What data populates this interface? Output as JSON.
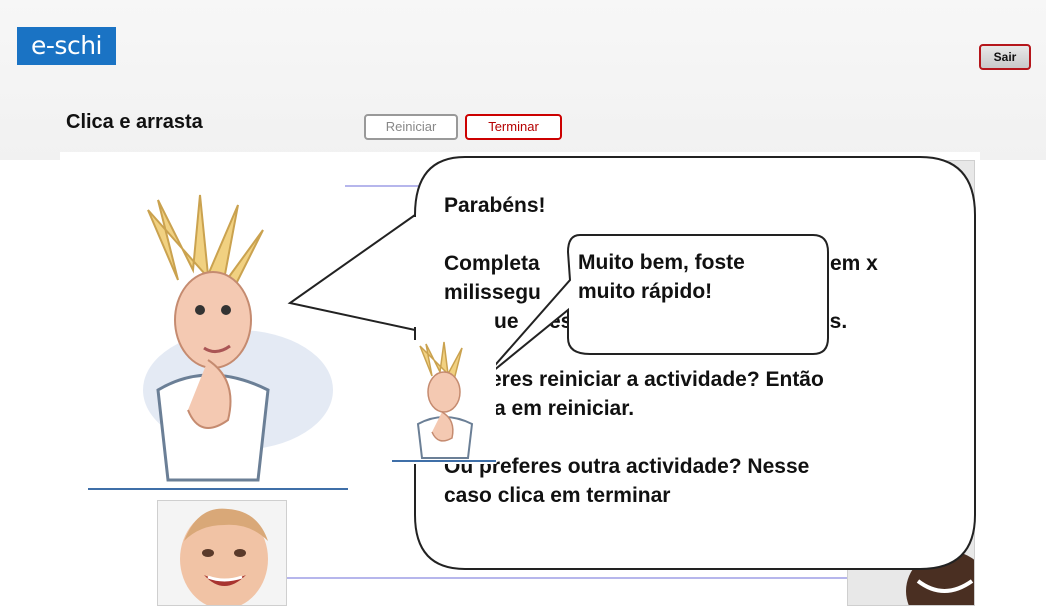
{
  "header": {
    "logo_text": "e-schi",
    "exit_label": "Sair",
    "title": "Clica e arrasta",
    "restart_label": "Reiniciar",
    "finish_label": "Terminar"
  },
  "dialog": {
    "line1": "Parabéns!",
    "line2": "Completa",
    "line2_tail": "em x",
    "line3": "milissegu",
    "line4_head": "ue",
    "line4_mid": "es",
    "line4_tail": "es.",
    "line5_head": "eres reiniciar a actividade? Então",
    "line6_head": "a em reiniciar.",
    "line7": "Ou preferes outra actividade? Nesse",
    "line8": "caso clica em terminar"
  },
  "small_dialog": {
    "line1": "Muito bem, foste",
    "line2": "muito rápido!"
  },
  "colors": {
    "logo_bg": "#1a73c4",
    "accent_red": "#c00000",
    "line_color": "#b6b6ec"
  }
}
